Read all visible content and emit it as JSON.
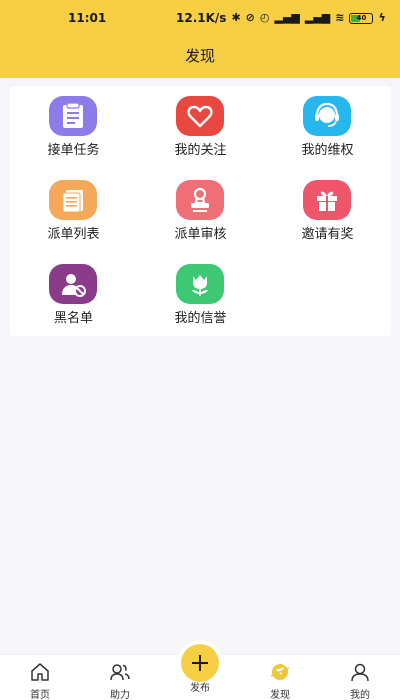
{
  "status_bar": {
    "time": "11:01",
    "speed": "12.1K/s",
    "battery": "40"
  },
  "header": {
    "title": "发现"
  },
  "grid": [
    {
      "label": "接单任务",
      "icon": "task-list-icon",
      "color": "#8e7bea"
    },
    {
      "label": "我的关注",
      "icon": "heart-icon",
      "color": "#e8483f"
    },
    {
      "label": "我的维权",
      "icon": "support-headset-icon",
      "color": "#27b7ef"
    },
    {
      "label": "派单列表",
      "icon": "document-list-icon",
      "color": "#f4a85a"
    },
    {
      "label": "派单审核",
      "icon": "stamp-icon",
      "color": "#ee6f76"
    },
    {
      "label": "邀请有奖",
      "icon": "gift-icon",
      "color": "#f0566a"
    },
    {
      "label": "黑名单",
      "icon": "blocked-user-icon",
      "color": "#8a3b8a"
    },
    {
      "label": "我的信誉",
      "icon": "tulip-icon",
      "color": "#3ec774"
    }
  ],
  "tabbar": {
    "home": "首页",
    "assist": "助力",
    "publish": "发布",
    "discover": "发现",
    "mine": "我的",
    "active_color": "#e9b820"
  }
}
